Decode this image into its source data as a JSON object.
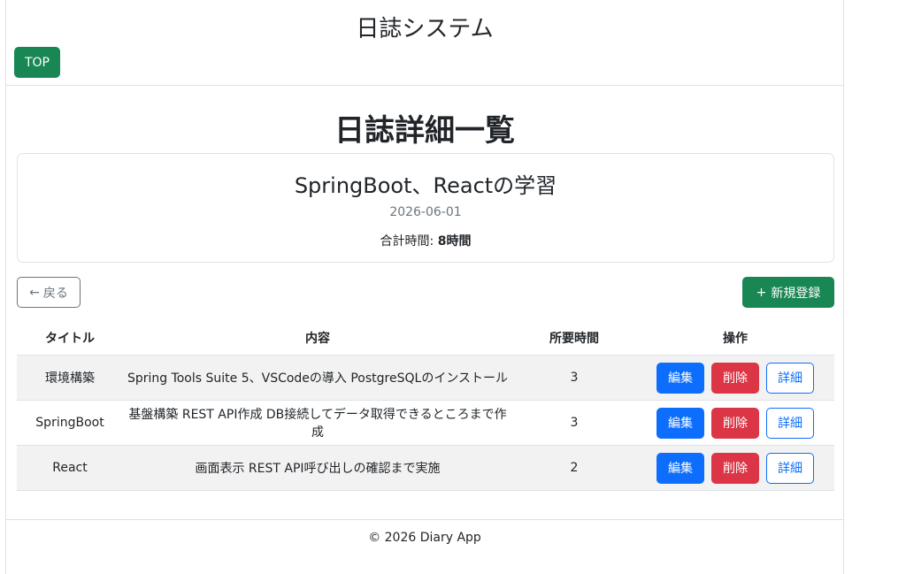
{
  "header": {
    "site_title": "日誌システム",
    "top_label": "TOP"
  },
  "main": {
    "page_title": "日誌詳細一覧",
    "diary": {
      "title": "SpringBoot、Reactの学習",
      "date": "2026-06-01",
      "total_label": "合計時間:",
      "total_value": "8時間"
    },
    "back_icon": "←",
    "back_label": "戻る",
    "new_icon": "+",
    "new_label": "新規登録",
    "table": {
      "headers": [
        "タイトル",
        "内容",
        "所要時間",
        "操作"
      ],
      "rows": [
        {
          "title": "環境構築",
          "content": "Spring Tools Suite 5、VSCodeの導入 PostgreSQLのインストール",
          "hours": "3"
        },
        {
          "title": "SpringBoot",
          "content": "基盤構築 REST API作成 DB接続してデータ取得できるところまで作成",
          "hours": "3"
        },
        {
          "title": "React",
          "content": "画面表示 REST API呼び出しの確認まで実施",
          "hours": "2"
        }
      ],
      "actions": {
        "edit": "編集",
        "delete": "削除",
        "detail": "詳細"
      }
    }
  },
  "footer": {
    "text": "© 2026 Diary App"
  },
  "colors": {
    "success": "#198754",
    "primary": "#0d6efd",
    "danger": "#dc3545",
    "secondary": "#6c757d"
  }
}
